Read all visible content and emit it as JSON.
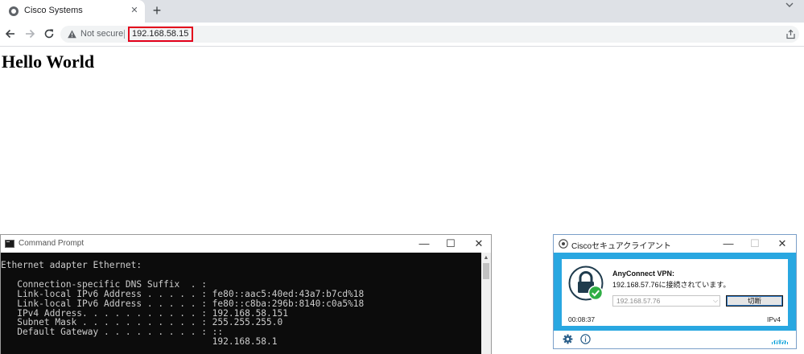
{
  "browser": {
    "tab_title": "Cisco Systems",
    "tab_close_glyph": "✕",
    "new_tab_glyph": "+",
    "security_label": "Not secure",
    "url": "192.168.58.15",
    "url_highlight_color": "#e3001b"
  },
  "page": {
    "heading": "Hello World"
  },
  "cmd": {
    "title": "Command Prompt",
    "min_glyph": "—",
    "max_glyph": "☐",
    "close_glyph": "✕",
    "scroll_up_glyph": "▲",
    "lines": "Ethernet adapter Ethernet:\n\n   Connection-specific DNS Suffix  . :\n   Link-local IPv6 Address . . . . . : fe80::aac5:40ed:43a7:b7cd%18\n   Link-local IPv6 Address . . . . . : fe80::c8ba:296b:8140:c0a5%18\n   IPv4 Address. . . . . . . . . . . : 192.168.58.151\n   Subnet Mask . . . . . . . . . . . : 255.255.255.0\n   Default Gateway . . . . . . . . . : ::\n                                       192.168.58.1"
  },
  "vpn": {
    "title": "Ciscoセキュアクライアント",
    "min_glyph": "—",
    "max_glyph": "☐",
    "close_glyph": "✕",
    "service_name": "AnyConnect VPN:",
    "status": "192.168.57.76に接続されています。",
    "server_value": "192.168.57.76",
    "dropdown_glyph": "⌵",
    "disconnect_label": "切断",
    "elapsed": "00:08:37",
    "protocol": "IPv4",
    "brand_word": "CISCO",
    "brand_color": "#049fd9",
    "panel_color": "#29a7e1",
    "connected_color": "#2fae45"
  }
}
